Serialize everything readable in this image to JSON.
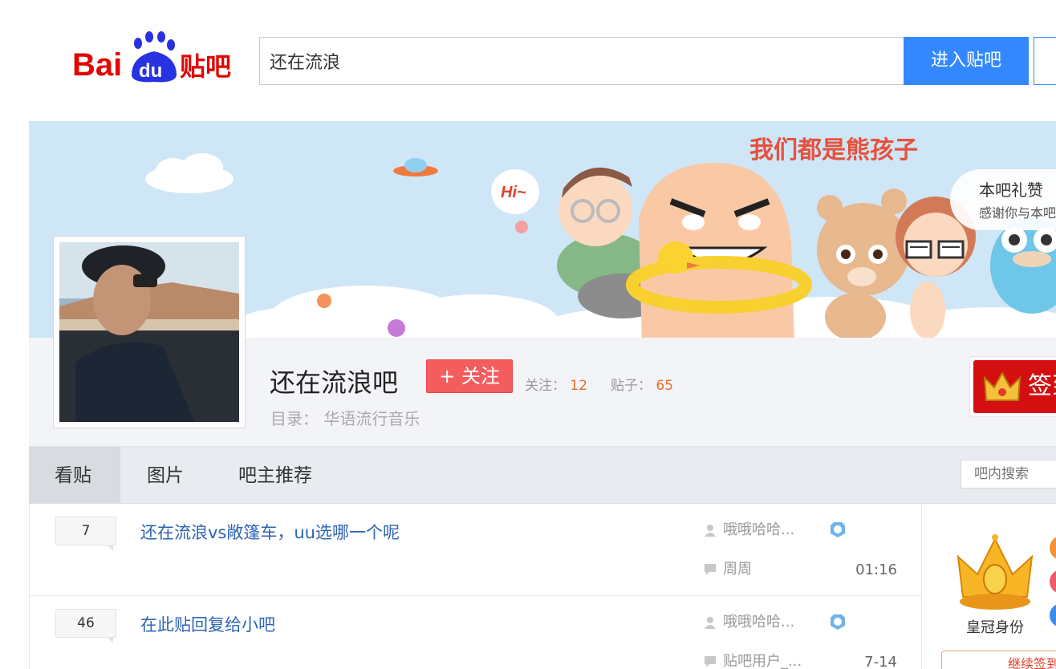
{
  "header": {
    "logo_text": "Bai du 贴吧",
    "search_value": "还在流浪",
    "search_button": "进入贴吧"
  },
  "banner": {
    "slogan": "我们都是熊孩子",
    "hi_text": "Hi~",
    "praise_title": "本吧礼赞",
    "praise_sub": "感谢你与本吧"
  },
  "forum": {
    "name": "还在流浪吧",
    "follow_button": "+ 关注",
    "follow_label": "关注：",
    "follow_count": "12",
    "posts_label": "贴子：",
    "posts_count": "65",
    "catalog_label": "目录：",
    "catalog_value": "华语流行音乐",
    "sign_button": "签到"
  },
  "tabs": [
    {
      "label": "看贴",
      "active": true
    },
    {
      "label": "图片",
      "active": false
    },
    {
      "label": "吧主推荐",
      "active": false
    }
  ],
  "forum_search_placeholder": "吧内搜索",
  "threads": [
    {
      "replies": "7",
      "title": "还在流浪vs敞篷车，uu选哪一个呢",
      "author": "哦哦哈哈...",
      "last_reply_user": "周周",
      "time": "01:16"
    },
    {
      "replies": "46",
      "title": "在此贴回复给小吧",
      "author": "哦哦哈哈...",
      "last_reply_user": "贴吧用户_...",
      "time": "7-14"
    }
  ],
  "aside": {
    "crown_label": "皇冠身份",
    "continue_button": "继续签到"
  },
  "colors": {
    "accent": "#3388ff",
    "follow": "#f45d5d",
    "sign": "#d30f0f",
    "link": "#2d64b3",
    "count": "#f06a2b"
  }
}
